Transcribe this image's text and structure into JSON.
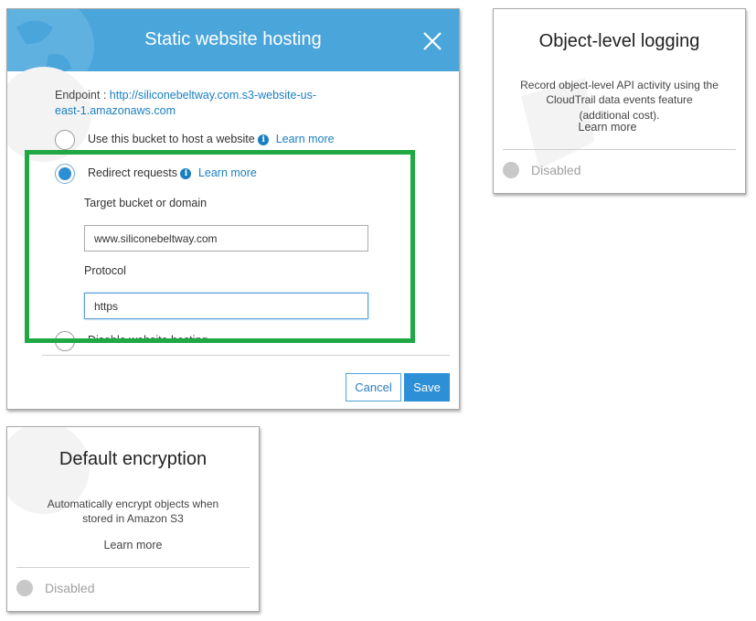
{
  "modal": {
    "title": "Static website hosting",
    "endpoint_label": "Endpoint : ",
    "endpoint_url_line1": "http://siliconebeltway.com.s3-website-us-",
    "endpoint_url_line2": "east-1.amazonaws.com",
    "options": [
      {
        "label": "Use this bucket to host a website",
        "learn_more": "Learn more",
        "checked": false
      },
      {
        "label": "Redirect requests",
        "learn_more": "Learn more",
        "checked": true
      },
      {
        "label": "Disable website hosting",
        "checked": false
      }
    ],
    "target_label": "Target bucket or domain",
    "target_value": "www.siliconebeltway.com",
    "protocol_label": "Protocol",
    "protocol_value": "https",
    "cancel_label": "Cancel",
    "save_label": "Save",
    "header_color": "#4aa5db",
    "highlight_color": "#1fa844"
  },
  "object_logging": {
    "title": "Object-level logging",
    "desc_line1": "Record object-level API activity using the",
    "desc_line2": "CloudTrail data events feature",
    "desc_line3": "(additional cost).",
    "learn_more": "Learn more",
    "status": "Disabled"
  },
  "default_encryption": {
    "title": "Default encryption",
    "desc_line1": "Automatically encrypt objects when",
    "desc_line2": "stored in Amazon S3",
    "learn_more": "Learn more",
    "status": "Disabled"
  },
  "icons": {
    "close": "close-icon",
    "info": "info-icon",
    "globe": "globe-icon"
  }
}
